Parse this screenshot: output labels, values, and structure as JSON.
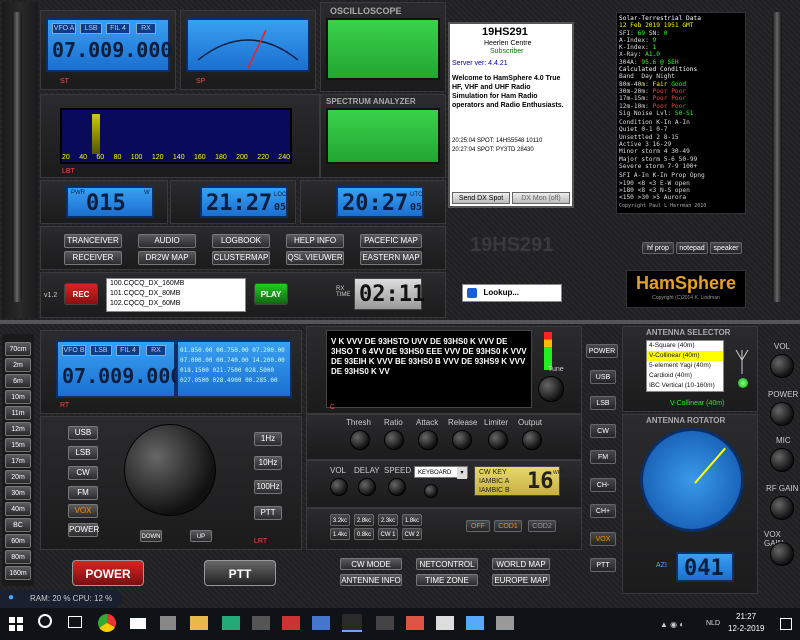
{
  "top": {
    "vfo_a": {
      "label": "VFO A",
      "band": "LSB",
      "filter": "FIL 4",
      "mode": "RX",
      "freq": "07.009.000"
    },
    "scope_title": "OSCILLOSCOPE",
    "spectrum_title": "SPECTRUM ANALYZER",
    "spectrum_scale": [
      "20",
      "40",
      "60",
      "80",
      "100",
      "120",
      "140",
      "160",
      "180",
      "200",
      "220",
      "240"
    ],
    "pwr": {
      "label": "PWR",
      "value": "015",
      "unit": "W"
    },
    "loc": {
      "value": "21:27",
      "sec": "05",
      "tag": "LOC"
    },
    "utc": {
      "value": "20:27",
      "sec": "05",
      "tag": "UTC"
    },
    "buttons": [
      [
        "TRANCEIVER",
        "AUDIO",
        "LOGBOOK",
        "HELP INFO",
        "PACEFIC MAP"
      ],
      [
        "RECEIVER",
        "DR2W MAP",
        "CLUSTERMAP",
        "QSL VIEUWER",
        "EASTERN MAP"
      ]
    ],
    "version": "v1.2",
    "rec": "REC",
    "play": "PLAY",
    "files": [
      "100.CQCQ_DX_160MB",
      "101.CQCQ_DX_80MB",
      "102.CQCQ_DX_60MB"
    ],
    "rx_time_label": "RX TIME",
    "rx_time": "02:11",
    "lookup": "Lookup...",
    "callsign_stamp": "19HS291",
    "tags": {
      "st": "ST",
      "sp": "SP",
      "lbt": "LBT",
      "rt": "R T",
      "sr": "SR"
    }
  },
  "info_panel": {
    "callsign": "19HS291",
    "location": "Heerlen Centre",
    "status": "Subscriber",
    "server": "Server ver: 4.4.21",
    "welcome": "Welcome to HamSphere 4.0 True HF, VHF and UHF Radio Simulation for Ham Radio operators and Radio Enthusiasts.",
    "spots": [
      "20:25:04 SPOT: 14HS5548 10110",
      "20:27:04 SPOT: PY3TD 28430"
    ],
    "send_btn": "Send DX Spot",
    "dxmon_btn": "DX Mon (off)"
  },
  "solar": {
    "title": "Solar-Terrestrial Data",
    "date": "12 Feb 2019 1951 GMT",
    "lines": [
      {
        "k": "SFI:",
        "v": "69",
        "k2": "SN:",
        "v2": "0"
      },
      {
        "k": "A-Index:",
        "v": "9"
      },
      {
        "k": "K-Index:",
        "v": "1"
      },
      {
        "k": "X-Ray:",
        "v": "A1.0"
      },
      {
        "k": "304A:",
        "v": "95.6 @ SEH"
      }
    ],
    "calc_title": "Calculated Conditions",
    "band_header": [
      "Band",
      "Day",
      "Night"
    ],
    "bands": [
      {
        "band": "80m-40m:",
        "day": "Fair",
        "night": "Good",
        "dc": "#ff0",
        "nc": "#2f2"
      },
      {
        "band": "30m-20m:",
        "day": "Poor",
        "night": "Poor",
        "dc": "#f44",
        "nc": "#f44"
      },
      {
        "band": "17m-15m:",
        "day": "Poor",
        "night": "Poor",
        "dc": "#f44",
        "nc": "#f44"
      },
      {
        "band": "12m-10m:",
        "day": "Poor",
        "night": "Poor",
        "dc": "#f44",
        "nc": "#f44"
      }
    ],
    "sig_noise": "Sig Noise Lvl:",
    "sig_noise_val": "S0-S1",
    "cond_table": [
      [
        "Condition",
        "K-In",
        "A-In"
      ],
      [
        "Quiet",
        "0-1",
        "0-7"
      ],
      [
        "Unsettled",
        "2",
        "8-15"
      ],
      [
        "Active",
        "3",
        "16-29"
      ],
      [
        "Minor storm",
        "4",
        "30-49"
      ],
      [
        "Major storm",
        "5-6",
        "50-99"
      ],
      [
        "Severe storm",
        "7-9",
        "100+"
      ]
    ],
    "sfi_table": [
      [
        "SFI",
        "A-In",
        "K-In Prop Opng"
      ],
      [
        ">190",
        "<8",
        "<3",
        "E-W open"
      ],
      [
        ">180",
        "<8",
        "<3",
        "N-S open"
      ],
      [
        "<150",
        ">30",
        ">5",
        "Aurora"
      ]
    ],
    "copyright": "Copyright Paul L Herrman 2010",
    "tabs": [
      "hf prop",
      "notepad",
      "speaker"
    ],
    "brand": "HamSphere",
    "brand_copy": "Copyright (C)2014 K. Lindman"
  },
  "bottom": {
    "bands": [
      "70cm",
      "2m",
      "6m",
      "10m",
      "11m",
      "12m",
      "15m",
      "17m",
      "20m",
      "30m",
      "40m",
      "BC",
      "60m",
      "80m",
      "160m"
    ],
    "vfo_b": {
      "label": "VFO B",
      "band": "LSB",
      "filter": "FIL 4",
      "mode": "RX",
      "freq": "07.009.000"
    },
    "mem_table": [
      [
        "01.850.00",
        "00.750.00",
        "07.200.00"
      ],
      [
        "07.000.00",
        "00.740.00",
        "14.200.00"
      ],
      [
        "018.1500",
        "021.7500",
        "028.5000"
      ],
      [
        "027.0500",
        "028.4900",
        "00.285.00"
      ]
    ],
    "mode_btns": [
      "USB",
      "LSB",
      "CW",
      "FM",
      "VOX",
      "POWER"
    ],
    "step_btns": [
      "1Hz",
      "10Hz",
      "100Hz",
      "PTT"
    ],
    "down_up": [
      "DOWN",
      "UP"
    ],
    "power_btn": "POWER",
    "ptt_btn": "PTT",
    "cw_text": "V K VVV DE 93HSTO UVV DE 93HS0 K VVV DE 3HSO T 6 4VV DE 93HS0 EEE VVV DE 93HS0 K VVV DE 93EIH K VVV BE 93HS0 B VVV DE 93HS9 K VVV DE 93HS0 K VV",
    "tune": "Tune",
    "audio_knobs": [
      "Thresh",
      "Ratio",
      "Attack",
      "Release",
      "Limiter",
      "Output"
    ],
    "cw_knobs": [
      "VOL",
      "DELAY",
      "SPEED"
    ],
    "keyboard": "KEYBOARD",
    "cw_key": {
      "line1": "CW KEY",
      "line2": "IAMBIC A",
      "line3": "IAMBIC B",
      "wpm": "16",
      "unit": "WPM"
    },
    "bw_btns": [
      [
        "3.2kc",
        "2.8kc",
        "2.3kc",
        "1.8kc"
      ],
      [
        "1.4kc",
        "0.8kc",
        "CW 1",
        "CW 2"
      ]
    ],
    "cod": [
      "OFF",
      "COD1",
      "COD2"
    ],
    "mid_btns": [
      "POWER",
      "USB",
      "LSB",
      "CW",
      "FM",
      "CH-",
      "CH+",
      "VOX",
      "PTT"
    ],
    "bottom_btns": [
      [
        "CW MODE",
        "NETCONTROL",
        "WORLD MAP"
      ],
      [
        "ANTENNE INFO",
        "TIME ZONE",
        "EUROPE MAP"
      ]
    ],
    "antenna_title": "ANTENNA SELECTOR",
    "antennas": [
      "4-Square (40m)",
      "V-Collinear (40m)",
      "5-element Yagi (40m)",
      "Cardioid (40m)",
      "IBC Vertical (10-160m)"
    ],
    "antenna_selected": "V-Collinear (40m)",
    "rotator_title": "ANTENNA ROTATOR",
    "azimuth_label": "AZI",
    "azimuth": "041",
    "right_knobs": [
      "VOL",
      "POWER",
      "MIC",
      "RF GAIN",
      "VOX GAIN"
    ],
    "tags": {
      "rt": "RT",
      "lrt": "LRT",
      "rpt": "RPT",
      "tr": "TR",
      "cd": "C"
    }
  },
  "status_line": "RAM: 20 %  CPU: 12 %",
  "taskbar": {
    "time": "21:27",
    "date": "12-2-2019",
    "lang": "NLD"
  }
}
